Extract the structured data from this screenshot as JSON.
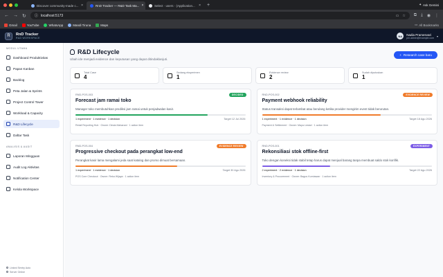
{
  "browser": {
    "tabs": [
      {
        "title": "Discover community-made c...",
        "active": false
      },
      {
        "title": "RnD Tracker — R&D Task Ma...",
        "active": true
      },
      {
        "title": "Select · users · (Application...",
        "active": false
      }
    ],
    "ask_label": "Ask Gemini",
    "url": "localhost:5173",
    "bookmarks": [
      {
        "label": "Gmail",
        "color": "#ea4335"
      },
      {
        "label": "YouTube",
        "color": "#ff0000"
      },
      {
        "label": "WhatsApp",
        "color": "#25d366"
      },
      {
        "label": "Mandi Tiruna",
        "color": "#8ab4f8"
      },
      {
        "label": "Maps",
        "color": "#34a853"
      }
    ],
    "all_bookmarks": "All Bookmarks"
  },
  "app": {
    "logo": "R",
    "name": "RnD Tracker",
    "tagline": "R&D WORKSPACE",
    "user": {
      "initials": "NA",
      "name": "Nadia Pramesvari",
      "email": "pm.admin@example.com"
    }
  },
  "sidebar": {
    "section1": "MODUL UTAMA",
    "main_items": [
      {
        "label": "Dashboard Produktivitas",
        "name": "sidebar-item-dashboard",
        "active": false
      },
      {
        "label": "Papan Kanban",
        "name": "sidebar-item-kanban",
        "active": false
      },
      {
        "label": "Backlog",
        "name": "sidebar-item-backlog",
        "active": false
      },
      {
        "label": "Peta Jalan & Sprints",
        "name": "sidebar-item-roadmap",
        "active": false
      },
      {
        "label": "Project Control Tower",
        "name": "sidebar-item-control-tower",
        "active": false
      },
      {
        "label": "Workload & Capacity",
        "name": "sidebar-item-workload",
        "active": false
      },
      {
        "label": "R&D Lifecycle",
        "name": "sidebar-item-rnd-lifecycle",
        "active": true
      },
      {
        "label": "Daftar Task",
        "name": "sidebar-item-tasks",
        "active": false
      }
    ],
    "section2": "ANALISIS & AUDIT",
    "audit_items": [
      {
        "label": "Laporan Mingguan",
        "name": "sidebar-item-weekly-report"
      },
      {
        "label": "Audit Log Aktivitas",
        "name": "sidebar-item-audit-log"
      },
      {
        "label": "Notification Center",
        "name": "sidebar-item-notifications"
      },
      {
        "label": "Kelola Workspace",
        "name": "sidebar-item-workspace"
      }
    ],
    "footer1": "Linked Sentry Auto",
    "footer2": "Server Online"
  },
  "main": {
    "title": "R&D Lifecycle",
    "subtitle": "Ubah ide menjadi evidence dan keputusan yang dapat ditindaklanjuti.",
    "new_button": "Research case baru",
    "stats": [
      {
        "label": "Total Case",
        "value": "4"
      },
      {
        "label": "Sedang eksperimen",
        "value": "1"
      },
      {
        "label": "Evidence review",
        "value": "2"
      },
      {
        "label": "Sudah diputuskan",
        "value": "1"
      }
    ],
    "cards": [
      {
        "code": "RND-POS-003",
        "badge": "DECIDED",
        "badge_color": "#22a45d",
        "title": "Forecast jam ramai toko",
        "desc": "Manager toko membutuhkan prediksi jam ramai untuk penjadwalan kasir.",
        "progress": 0.78,
        "bar_color": "#22a45d",
        "counts": "1 experiment · 1 evidence · 1 decision",
        "target": "Target 12 Jul 2026",
        "owner": "Retail Reporting Hub · Owner: Dinda Maharani · 1 action item"
      },
      {
        "code": "RND-POS-002",
        "badge": "EVIDENCE REVIEW",
        "badge_color": "#f07b2a",
        "title": "Payment webhook reliability",
        "desc": "Status transaksi dapat terlambat atau berulang ketika provider mengirim event tidak berurutan.",
        "progress": 0.7,
        "bar_color": "#f07b2a",
        "counts": "1 experiment · 1 evidence · 1 decision",
        "target": "Target 18 Agu 2026",
        "owner": "Payment & Settlement · Owner: Maya Lestari · 1 action item"
      },
      {
        "code": "RND-POS-004",
        "badge": "EVIDENCE REVIEW",
        "badge_color": "#f07b2a",
        "title": "Progressive checkout pada perangkat low-end",
        "desc": "Perangkat kasir lama mengalami jeda saat katalog dan promo dimuat bersamaan.",
        "progress": 0.6,
        "bar_color": "#f07b2a",
        "counts": "1 experiment · 1 evidence · 1 decision",
        "target": "Target 30 Agu 2026",
        "owner": "POS Core Checkout · Owner: Reka Wijaya · 1 action item"
      },
      {
        "code": "RND-POS-001",
        "badge": "EXPERIMENT",
        "badge_color": "#7c5ce6",
        "title": "Rekonsiliasi stok offline-first",
        "desc": "Toko dengan koneksi tidak stabil tetap harus dapat menjual barang tanpa membuat saldo stok konflik.",
        "progress": 0.4,
        "bar_color": "#7c5ce6",
        "counts": "2 experiment · 2 evidence · 1 decision",
        "target": "Target 22 Agu 2026",
        "owner": "Inventory & Procurement · Owner: Bagus Kurniawan · 1 action item"
      }
    ]
  }
}
